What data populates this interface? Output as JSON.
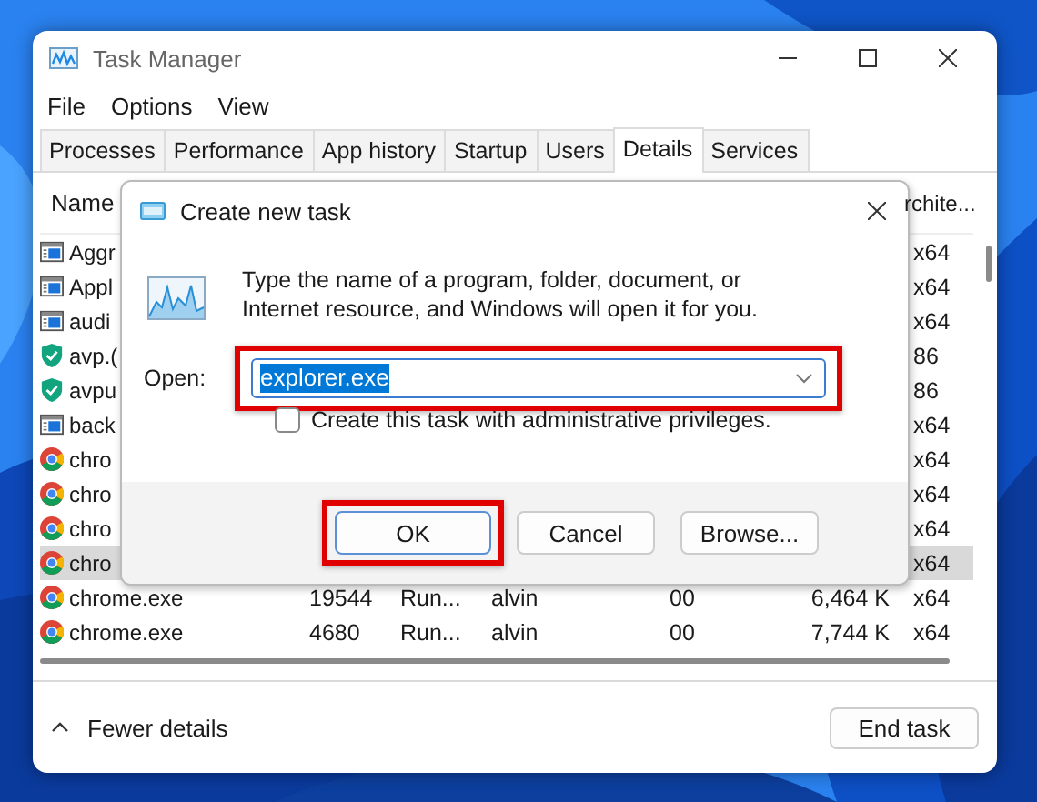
{
  "window": {
    "title": "Task Manager"
  },
  "menu": [
    "File",
    "Options",
    "View"
  ],
  "tabs": [
    {
      "label": "Processes",
      "selected": false
    },
    {
      "label": "Performance",
      "selected": false
    },
    {
      "label": "App history",
      "selected": false
    },
    {
      "label": "Startup",
      "selected": false
    },
    {
      "label": "Users",
      "selected": false
    },
    {
      "label": "Details",
      "selected": true
    },
    {
      "label": "Services",
      "selected": false
    }
  ],
  "table": {
    "columns": [
      "Name",
      "rchite..."
    ],
    "rows": [
      {
        "kind": "app",
        "name": "Aggr",
        "arch": "x64",
        "selected": false
      },
      {
        "kind": "app",
        "name": "Appl",
        "arch": "x64",
        "selected": false
      },
      {
        "kind": "app",
        "name": "audi",
        "arch": "x64",
        "selected": false
      },
      {
        "kind": "shield",
        "name": "avp.(",
        "arch": "86",
        "selected": false
      },
      {
        "kind": "shield",
        "name": "avpu",
        "arch": "86",
        "selected": false
      },
      {
        "kind": "app",
        "name": "back",
        "arch": "x64",
        "selected": false
      },
      {
        "kind": "chrome",
        "name": "chro",
        "arch": "x64",
        "selected": false
      },
      {
        "kind": "chrome",
        "name": "chro",
        "arch": "x64",
        "selected": false
      },
      {
        "kind": "chrome",
        "name": "chro",
        "arch": "x64",
        "selected": false
      },
      {
        "kind": "chrome",
        "name": "chro",
        "arch": "x64",
        "selected": true
      },
      {
        "kind": "chrome",
        "name": "chrome.exe",
        "pid": "19544",
        "status": "Run...",
        "user": "alvin",
        "cpu": "00",
        "memory": "6,464 K",
        "arch": "x64",
        "selected": false
      },
      {
        "kind": "chrome",
        "name": "chrome.exe",
        "pid": "4680",
        "status": "Run...",
        "user": "alvin",
        "cpu": "00",
        "memory": "7,744 K",
        "arch": "x64",
        "selected": false
      }
    ]
  },
  "dialog": {
    "title": "Create new task",
    "message": "Type the name of a program, folder, document, or Internet resource, and Windows will open it for you.",
    "open_label": "Open:",
    "open_value": "explorer.exe",
    "open_highlighted": true,
    "admin_checkbox": {
      "label": "Create this task with administrative privileges.",
      "checked": false
    },
    "buttons": [
      {
        "label": "OK",
        "default": true,
        "highlighted": true
      },
      {
        "label": "Cancel",
        "default": false,
        "highlighted": false
      },
      {
        "label": "Browse...",
        "default": false,
        "highlighted": false
      }
    ]
  },
  "footer": {
    "fewer_details": "Fewer details",
    "end_task": "End task"
  }
}
